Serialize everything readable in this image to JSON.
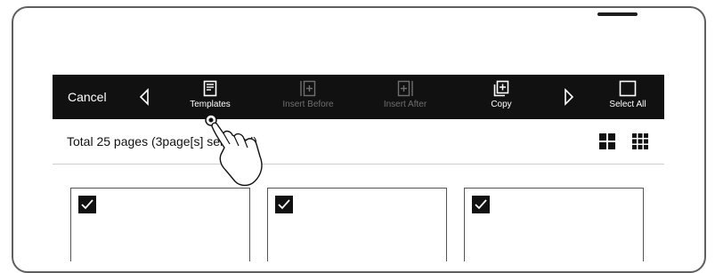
{
  "toolbar": {
    "cancel_label": "Cancel",
    "templates_label": "Templates",
    "insert_before_label": "Insert Before",
    "insert_after_label": "Insert After",
    "copy_label": "Copy",
    "select_all_label": "Select All"
  },
  "info": {
    "total_text": "Total 25 pages (3page[s] selected)"
  },
  "thumbnails": [
    {
      "selected": true
    },
    {
      "selected": true
    },
    {
      "selected": true
    }
  ],
  "colors": {
    "toolbar_bg": "#111111",
    "disabled_text": "#6f6f6f"
  },
  "icons": [
    "chevron-left-icon",
    "templates-icon",
    "insert-before-icon",
    "insert-after-icon",
    "copy-icon",
    "chevron-right-icon",
    "select-all-icon",
    "grid-4-icon",
    "grid-9-icon",
    "check-icon",
    "hand-pointer-icon"
  ]
}
